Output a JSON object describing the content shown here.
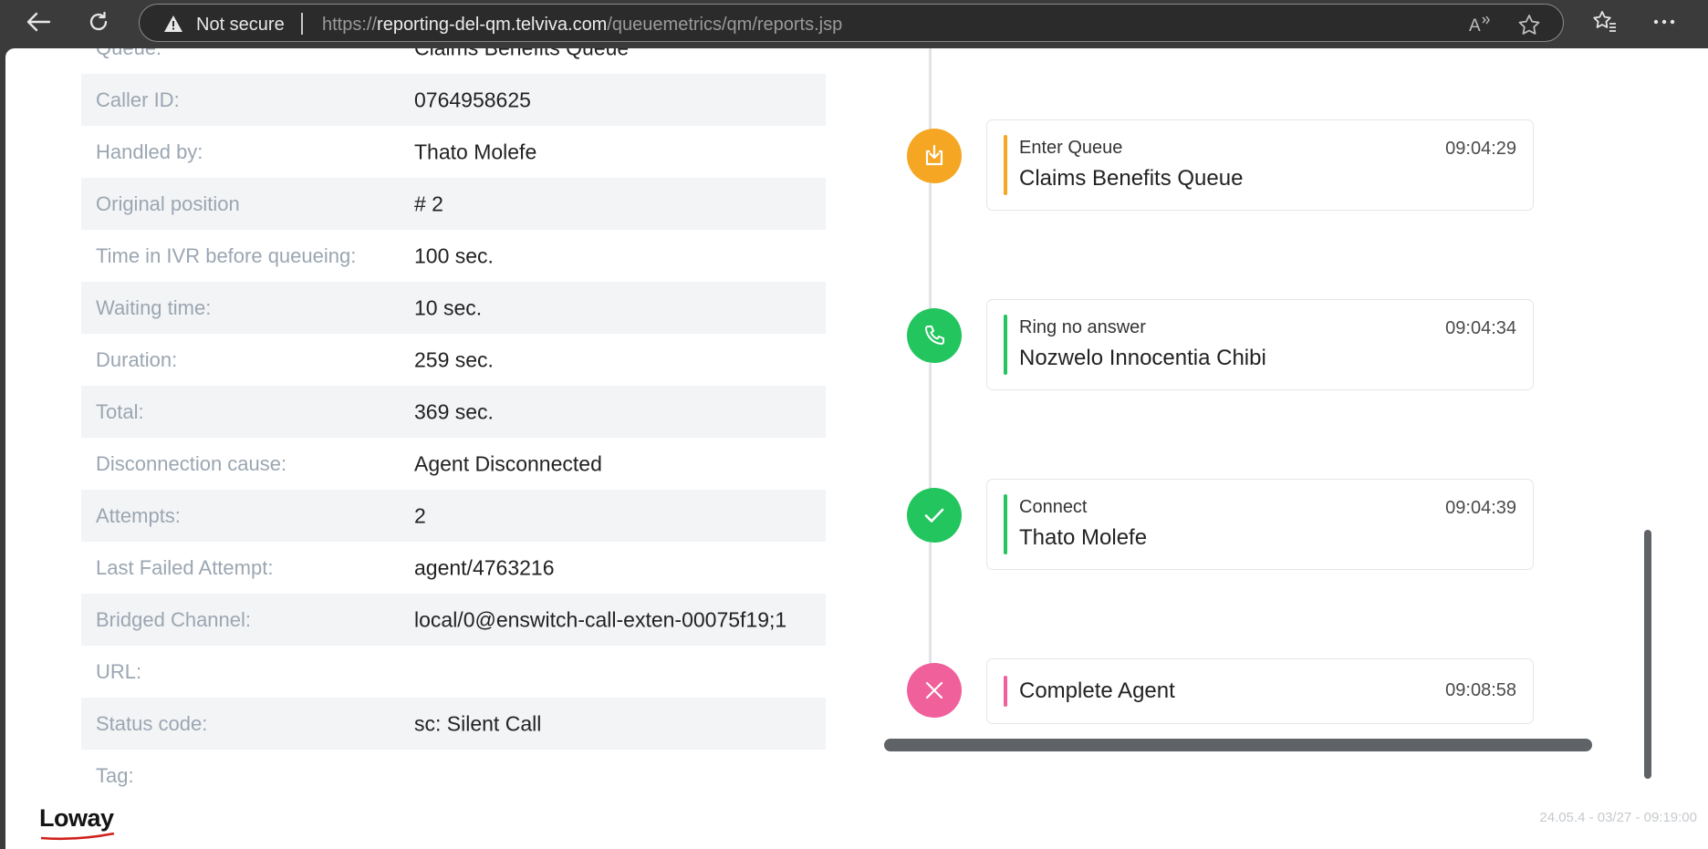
{
  "browser": {
    "security_label": "Not secure",
    "url_prefix": "https://",
    "url_host": "reporting-del-qm.telviva.com",
    "url_path": "/queuemetrics/qm/reports.jsp"
  },
  "details": [
    {
      "label": "Queue:",
      "value": "Claims Benefits Queue"
    },
    {
      "label": "Caller ID:",
      "value": "0764958625"
    },
    {
      "label": "Handled by:",
      "value": "Thato Molefe"
    },
    {
      "label": "Original position",
      "value": "# 2"
    },
    {
      "label": "Time in IVR before queueing:",
      "value": "100 sec."
    },
    {
      "label": "Waiting time:",
      "value": "10 sec."
    },
    {
      "label": "Duration:",
      "value": "259 sec."
    },
    {
      "label": "Total:",
      "value": "369 sec."
    },
    {
      "label": "Disconnection cause:",
      "value": "Agent Disconnected"
    },
    {
      "label": "Attempts:",
      "value": "2"
    },
    {
      "label": "Last Failed Attempt:",
      "value": "agent/4763216"
    },
    {
      "label": "Bridged Channel:",
      "value": "local/0@enswitch-call-exten-00075f19;1"
    },
    {
      "label": "URL:",
      "value": ""
    },
    {
      "label": "Status code:",
      "value": "sc: Silent Call"
    },
    {
      "label": "Tag:",
      "value": ""
    }
  ],
  "timeline": [
    {
      "event": "Enter Queue",
      "detail": "Claims Benefits Queue",
      "time": "09:04:29",
      "icon": "queue-enter-icon",
      "color": "#f5a623",
      "accent": "#f5a623"
    },
    {
      "event": "Ring no answer",
      "detail": "Nozwelo Innocentia Chibi",
      "time": "09:04:34",
      "icon": "phone-icon",
      "color": "#22c55e",
      "accent": "#22c55e"
    },
    {
      "event": "Connect",
      "detail": "Thato Molefe",
      "time": "09:04:39",
      "icon": "check-icon",
      "color": "#22c55e",
      "accent": "#22c55e"
    },
    {
      "event": "Complete Agent",
      "detail": "",
      "time": "09:08:58",
      "icon": "close-icon",
      "color": "#f0609a",
      "accent": "#f0609a"
    }
  ],
  "footer": {
    "logo_text": "Loway",
    "version": "24.05.4 - 03/27 - 09:19:00"
  }
}
